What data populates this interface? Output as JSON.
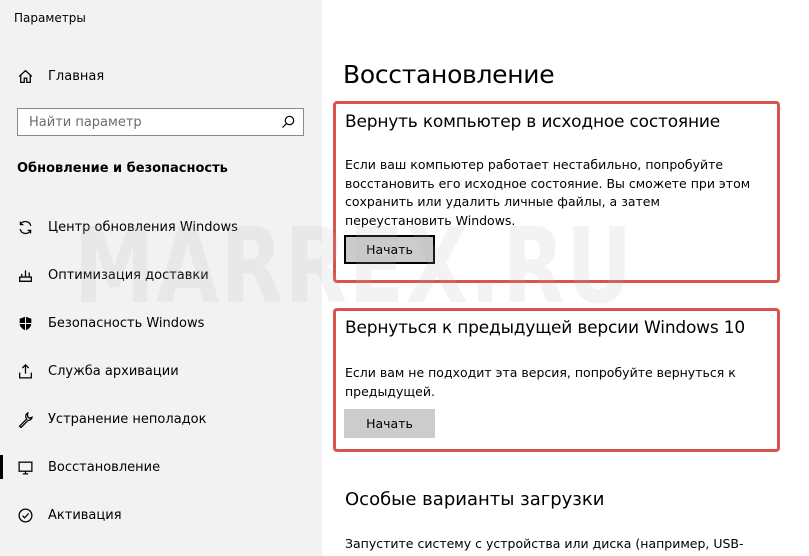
{
  "window": {
    "title": "Параметры"
  },
  "sidebar": {
    "home_label": "Главная",
    "search": {
      "placeholder": "Найти параметр",
      "value": ""
    },
    "section_title": "Обновление и безопасность",
    "items": [
      {
        "label": "Центр обновления Windows",
        "icon": "sync-icon"
      },
      {
        "label": "Оптимизация доставки",
        "icon": "delivery-icon"
      },
      {
        "label": "Безопасность Windows",
        "icon": "shield-icon"
      },
      {
        "label": "Служба архивации",
        "icon": "backup-icon"
      },
      {
        "label": "Устранение неполадок",
        "icon": "wrench-icon"
      },
      {
        "label": "Восстановление",
        "icon": "recovery-icon",
        "active": true
      },
      {
        "label": "Активация",
        "icon": "activation-icon"
      }
    ]
  },
  "main": {
    "title": "Восстановление",
    "reset": {
      "title": "Вернуть компьютер в исходное состояние",
      "description": "Если ваш компьютер работает нестабильно, попробуйте восстановить его исходное состояние. Вы сможете при этом сохранить или удалить личные файлы, а затем переустановить Windows.",
      "button_label": "Начать"
    },
    "rollback": {
      "title": "Вернуться к предыдущей версии Windows 10",
      "description": "Если вам не подходит эта версия, попробуйте вернуться к предыдущей.",
      "button_label": "Начать"
    },
    "advanced": {
      "title": "Особые варианты загрузки",
      "description": "Запустите систему с устройства или диска (например, USB-"
    }
  },
  "watermark": "MARREX.RU",
  "colors": {
    "highlight_border": "#d9534f",
    "sidebar_bg": "#f2f2f2",
    "button_bg": "#cccccc"
  }
}
